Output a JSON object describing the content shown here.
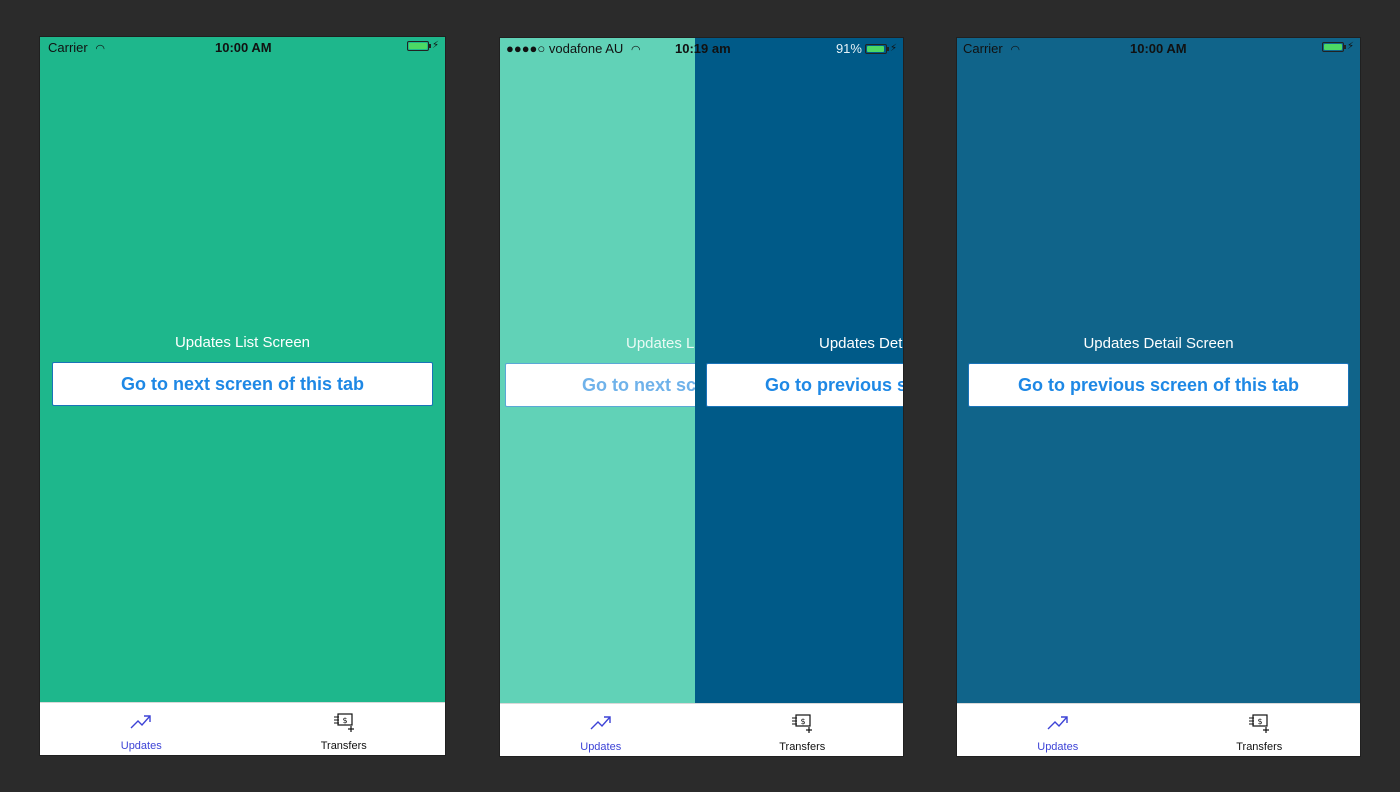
{
  "phone1": {
    "status": {
      "carrier": "Carrier",
      "time": "10:00 AM"
    },
    "label": "Updates List Screen",
    "button": "Go to next screen of this tab",
    "bg_color": "#1eb78c"
  },
  "phone2": {
    "status": {
      "carrier": "●●●●○ vodafone AU",
      "time": "10:19 am",
      "battery": "91%"
    },
    "back_screen": {
      "label": "Updates L",
      "button": "Go to next scr",
      "bg_color": "#61d2b7"
    },
    "front_screen": {
      "label": "Updates Det",
      "button": "Go to previous sc",
      "bg_color": "#005a88"
    }
  },
  "phone3": {
    "status": {
      "carrier": "Carrier",
      "time": "10:00 AM"
    },
    "label": "Updates Detail Screen",
    "button": "Go to previous screen of this tab",
    "bg_color": "#10648a"
  },
  "tabs": [
    {
      "label": "Updates",
      "icon": "trending-up-icon",
      "active": true
    },
    {
      "label": "Transfers",
      "icon": "money-transfer-icon",
      "active": false
    }
  ],
  "colors": {
    "active_tab": "#3d43d6",
    "button_text": "#1e88e5",
    "background": "#2b2b2b"
  }
}
